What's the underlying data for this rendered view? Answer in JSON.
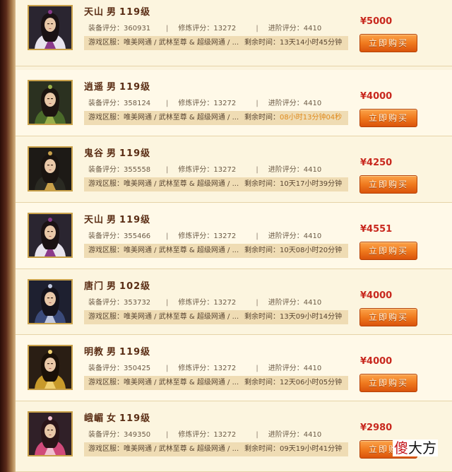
{
  "labels": {
    "equip": "装备评分：",
    "refine": "修炼评分：",
    "advance": "进阶评分：",
    "server": "游戏区服：",
    "time_left": "剩余时间：",
    "buy": "立即购买"
  },
  "listings": [
    {
      "faction": "天山",
      "gender": "男",
      "level": "119级",
      "equip": "360931",
      "refine": "13272",
      "advance": "4410",
      "server": "唯美网通 / 武林至尊 & 超级网通 / ...",
      "time": "13天14小时45分钟",
      "urgent": false,
      "price": "¥5000",
      "portrait": "tianshan"
    },
    {
      "faction": "逍遥",
      "gender": "男",
      "level": "119级",
      "equip": "358124",
      "refine": "13272",
      "advance": "4410",
      "server": "唯美网通 / 武林至尊 & 超级网通 / ...",
      "time": "08小时13分钟04秒",
      "urgent": true,
      "price": "¥4000",
      "portrait": "xiaoyao"
    },
    {
      "faction": "鬼谷",
      "gender": "男",
      "level": "119级",
      "equip": "355558",
      "refine": "13272",
      "advance": "4410",
      "server": "唯美网通 / 武林至尊 & 超级网通 / ...",
      "time": "10天17小时39分钟",
      "urgent": false,
      "price": "¥4250",
      "portrait": "guigu"
    },
    {
      "faction": "天山",
      "gender": "男",
      "level": "119级",
      "equip": "355466",
      "refine": "13272",
      "advance": "4410",
      "server": "唯美网通 / 武林至尊 & 超级网通 / ...",
      "time": "10天08小时20分钟",
      "urgent": false,
      "price": "¥4551",
      "portrait": "tianshan"
    },
    {
      "faction": "唐门",
      "gender": "男",
      "level": "102级",
      "equip": "353732",
      "refine": "13272",
      "advance": "4410",
      "server": "唯美网通 / 武林至尊 & 超级网通 / ...",
      "time": "13天09小时14分钟",
      "urgent": false,
      "price": "¥4000",
      "portrait": "tangmen"
    },
    {
      "faction": "明教",
      "gender": "男",
      "level": "119级",
      "equip": "350425",
      "refine": "13272",
      "advance": "4410",
      "server": "唯美网通 / 武林至尊 & 超级网通 / ...",
      "time": "12天06小时05分钟",
      "urgent": false,
      "price": "¥4000",
      "portrait": "mingjiao"
    },
    {
      "faction": "峨嵋",
      "gender": "女",
      "level": "119级",
      "equip": "349350",
      "refine": "13272",
      "advance": "4410",
      "server": "唯美网通 / 武林至尊 & 超级网通 / ...",
      "time": "09天19小时41分钟",
      "urgent": false,
      "price": "¥2980",
      "portrait": "emei"
    }
  ],
  "colors": {
    "price": "#c8281e",
    "urgent_time": "#e08a1c",
    "button": "#f07a1e"
  },
  "watermark": {
    "part1": "傻",
    "part2": "大方"
  }
}
